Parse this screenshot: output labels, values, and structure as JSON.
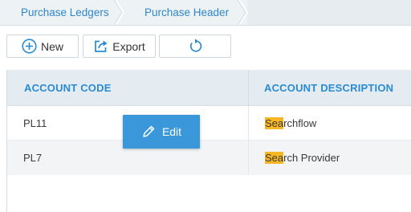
{
  "breadcrumb": {
    "items": [
      {
        "label": "Purchase Ledgers"
      },
      {
        "label": "Purchase Header"
      }
    ]
  },
  "toolbar": {
    "new_label": "New",
    "export_label": "Export",
    "refresh_icon": "refresh-icon"
  },
  "grid": {
    "columns": [
      "ACCOUNT CODE",
      "ACCOUNT DESCRIPTION"
    ],
    "rows": [
      {
        "code": "PL11",
        "desc_highlight": "Sea",
        "desc_rest": "rchflow"
      },
      {
        "code": "PL7",
        "desc_highlight": "Sea",
        "desc_rest": "rch Provider"
      }
    ]
  },
  "edit_popup": {
    "label": "Edit"
  },
  "colors": {
    "accent": "#2a8bd2",
    "edit_button": "#3a97d9",
    "highlight": "#f7b724",
    "header_bg": "#e4ecf1"
  }
}
